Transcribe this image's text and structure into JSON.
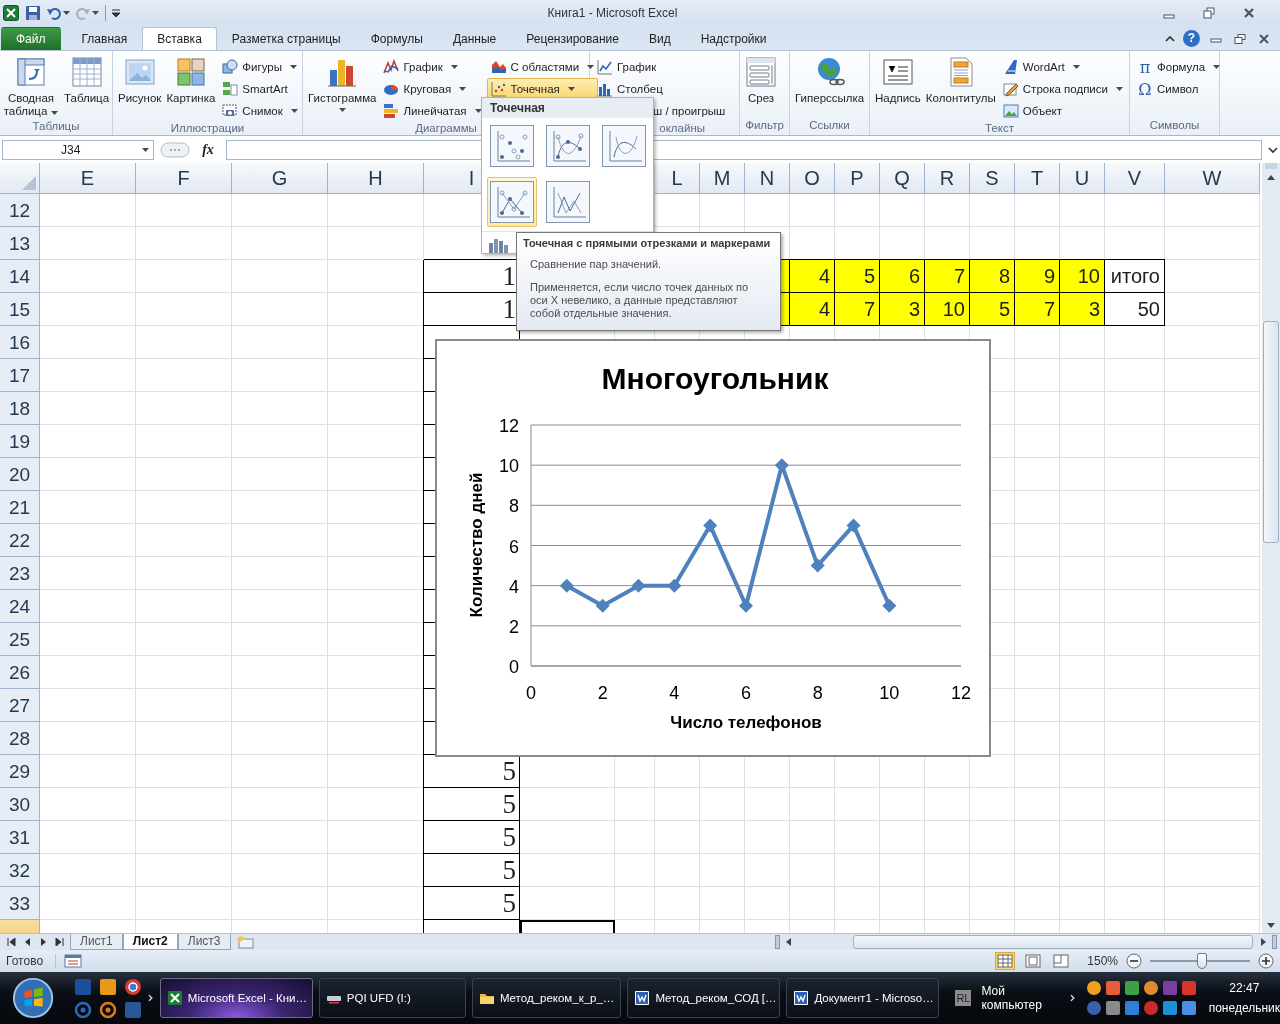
{
  "window": {
    "title": "Книга1  -  Microsoft Excel"
  },
  "tabs": [
    {
      "label": "Файл",
      "kind": "file",
      "selected": false
    },
    {
      "label": "Главная",
      "kind": "tab",
      "selected": false
    },
    {
      "label": "Вставка",
      "kind": "tab",
      "selected": true
    },
    {
      "label": "Разметка страницы",
      "kind": "tab",
      "selected": false
    },
    {
      "label": "Формулы",
      "kind": "tab",
      "selected": false
    },
    {
      "label": "Данные",
      "kind": "tab",
      "selected": false
    },
    {
      "label": "Рецензирование",
      "kind": "tab",
      "selected": false
    },
    {
      "label": "Вид",
      "kind": "tab",
      "selected": false
    },
    {
      "label": "Надстройки",
      "kind": "tab",
      "selected": false
    }
  ],
  "help": "?",
  "ribbon": {
    "groups": [
      {
        "label": "Таблицы",
        "items": [
          {
            "kind": "large",
            "label": "Сводная таблица",
            "dropdown": true
          },
          {
            "kind": "large",
            "label": "Таблица",
            "dropdown": false
          }
        ]
      },
      {
        "label": "Иллюстрации",
        "items": [
          {
            "kind": "large",
            "label": "Рисунок",
            "dropdown": false
          },
          {
            "kind": "large",
            "label": "Картинка",
            "dropdown": false
          },
          {
            "kind": "stack",
            "items": [
              {
                "label": "Фигуры",
                "dropdown": true,
                "selected": false
              },
              {
                "label": "SmartArt",
                "dropdown": false,
                "selected": false
              },
              {
                "label": "Снимок",
                "dropdown": true,
                "selected": false
              }
            ]
          }
        ]
      },
      {
        "label": "Диаграммы",
        "items": [
          {
            "kind": "large",
            "label": "Гистограмма",
            "dropdown": true
          },
          {
            "kind": "stack",
            "items": [
              {
                "label": "График",
                "dropdown": true,
                "selected": false
              },
              {
                "label": "Круговая",
                "dropdown": true,
                "selected": false
              },
              {
                "label": "Линейчатая",
                "dropdown": true,
                "selected": false
              }
            ]
          },
          {
            "kind": "stack",
            "items": [
              {
                "label": "С областями",
                "dropdown": true,
                "selected": false
              },
              {
                "label": "Точечная",
                "dropdown": true,
                "selected": true
              }
            ]
          }
        ]
      },
      {
        "label": "оклайны",
        "items": [
          {
            "kind": "stack",
            "items": [
              {
                "label": "График",
                "dropdown": false,
                "selected": false
              },
              {
                "label": "Столбец",
                "dropdown": false,
                "selected": false
              },
              {
                "label": "ш / проигрыш",
                "kind": "cut",
                "dropdown": false,
                "selected": false
              }
            ]
          }
        ]
      },
      {
        "label": "Фильтр",
        "items": [
          {
            "kind": "large",
            "label": "Срез",
            "dropdown": false
          }
        ]
      },
      {
        "label": "Ссылки",
        "items": [
          {
            "kind": "large",
            "label": "Гиперссылка",
            "dropdown": false
          }
        ]
      },
      {
        "label": "Текст",
        "items": [
          {
            "kind": "large",
            "label": "Надпись",
            "dropdown": false
          },
          {
            "kind": "large",
            "label": "Колонтитулы",
            "dropdown": false
          },
          {
            "kind": "stack",
            "items": [
              {
                "label": "WordArt",
                "dropdown": true,
                "selected": false
              },
              {
                "label": "Строка подписи",
                "dropdown": true,
                "selected": false
              },
              {
                "label": "Объект",
                "dropdown": false,
                "selected": false
              }
            ]
          }
        ]
      },
      {
        "label": "Символы",
        "items": [
          {
            "kind": "stack",
            "items": [
              {
                "label": "Формула",
                "glyph": "π",
                "dropdown": true,
                "selected": false
              },
              {
                "label": "Символ",
                "glyph": "Ω",
                "dropdown": false,
                "selected": false
              }
            ]
          }
        ]
      }
    ]
  },
  "formula_bar": {
    "name_box": "J34",
    "fx": "fx"
  },
  "sheet": {
    "columns_left": [
      "E",
      "F",
      "G",
      "H",
      "I"
    ],
    "columns_right": [
      "L",
      "M",
      "N",
      "O",
      "P",
      "Q",
      "R",
      "S",
      "T",
      "U",
      "V",
      "W"
    ],
    "rows": [
      {
        "number": "12",
        "selected": false
      },
      {
        "number": "13",
        "selected": false
      },
      {
        "number": "14",
        "selected": false,
        "cells": [
          null,
          null,
          null,
          null,
          {
            "text": "1",
            "boxed": true,
            "highlighted": false,
            "selected": false
          },
          null,
          null,
          null,
          null,
          {
            "boxed": true,
            "highlighted": true,
            "selected": false
          },
          {
            "text": "4",
            "boxed": true,
            "highlighted": true,
            "selected": false
          },
          {
            "text": "5",
            "boxed": true,
            "highlighted": true,
            "selected": false
          },
          {
            "text": "6",
            "boxed": true,
            "highlighted": true,
            "selected": false
          },
          {
            "text": "7",
            "boxed": true,
            "highlighted": true,
            "selected": false
          },
          {
            "text": "8",
            "boxed": true,
            "highlighted": true,
            "selected": false
          },
          {
            "text": "9",
            "boxed": true,
            "highlighted": true,
            "selected": false
          },
          {
            "text": "10",
            "boxed": true,
            "highlighted": true,
            "selected": false
          },
          {
            "text": "итого",
            "boxed": true,
            "highlighted": false,
            "selected": false
          }
        ]
      },
      {
        "number": "15",
        "selected": false,
        "cells": [
          null,
          null,
          null,
          null,
          {
            "text": "1",
            "boxed": true,
            "highlighted": false,
            "selected": false
          },
          null,
          null,
          null,
          null,
          {
            "boxed": true,
            "highlighted": true,
            "selected": false
          },
          {
            "text": "4",
            "boxed": true,
            "highlighted": true,
            "selected": false
          },
          {
            "text": "7",
            "boxed": true,
            "highlighted": true,
            "selected": false
          },
          {
            "text": "3",
            "boxed": true,
            "highlighted": true,
            "selected": false
          },
          {
            "text": "10",
            "boxed": true,
            "highlighted": true,
            "selected": false
          },
          {
            "text": "5",
            "boxed": true,
            "highlighted": true,
            "selected": false
          },
          {
            "text": "7",
            "boxed": true,
            "highlighted": true,
            "selected": false
          },
          {
            "text": "3",
            "boxed": true,
            "highlighted": true,
            "selected": false
          },
          {
            "text": "50",
            "boxed": true,
            "highlighted": false,
            "selected": false
          }
        ]
      },
      {
        "number": "16",
        "selected": false,
        "cells": [
          null,
          null,
          null,
          null,
          {
            "boxed": true,
            "highlighted": false,
            "selected": false
          }
        ]
      },
      {
        "number": "17",
        "selected": false,
        "cells": [
          null,
          null,
          null,
          null,
          {
            "boxed": true,
            "highlighted": false,
            "selected": false
          }
        ]
      },
      {
        "number": "18",
        "selected": false,
        "cells": [
          null,
          null,
          null,
          null,
          {
            "boxed": true,
            "highlighted": false,
            "selected": false
          }
        ]
      },
      {
        "number": "19",
        "selected": false,
        "cells": [
          null,
          null,
          null,
          null,
          {
            "boxed": true,
            "highlighted": false,
            "selected": false
          }
        ]
      },
      {
        "number": "20",
        "selected": false,
        "cells": [
          null,
          null,
          null,
          null,
          {
            "boxed": true,
            "highlighted": false,
            "selected": false
          }
        ]
      },
      {
        "number": "21",
        "selected": false,
        "cells": [
          null,
          null,
          null,
          null,
          {
            "boxed": true,
            "highlighted": false,
            "selected": false
          }
        ]
      },
      {
        "number": "22",
        "selected": false,
        "cells": [
          null,
          null,
          null,
          null,
          {
            "boxed": true,
            "highlighted": false,
            "selected": false
          }
        ]
      },
      {
        "number": "23",
        "selected": false,
        "cells": [
          null,
          null,
          null,
          null,
          {
            "boxed": true,
            "highlighted": false,
            "selected": false
          }
        ]
      },
      {
        "number": "24",
        "selected": false,
        "cells": [
          null,
          null,
          null,
          null,
          {
            "boxed": true,
            "highlighted": false,
            "selected": false
          }
        ]
      },
      {
        "number": "25",
        "selected": false,
        "cells": [
          null,
          null,
          null,
          null,
          {
            "boxed": true,
            "highlighted": false,
            "selected": false
          }
        ]
      },
      {
        "number": "26",
        "selected": false,
        "cells": [
          null,
          null,
          null,
          null,
          {
            "boxed": true,
            "highlighted": false,
            "selected": false
          }
        ]
      },
      {
        "number": "27",
        "selected": false,
        "cells": [
          null,
          null,
          null,
          null,
          {
            "boxed": true,
            "highlighted": false,
            "selected": false
          }
        ]
      },
      {
        "number": "28",
        "selected": false,
        "cells": [
          null,
          null,
          null,
          null,
          {
            "boxed": true,
            "highlighted": false,
            "selected": false
          }
        ]
      },
      {
        "number": "29",
        "selected": false,
        "cells": [
          null,
          null,
          null,
          null,
          {
            "text": "5",
            "boxed": true,
            "highlighted": false,
            "selected": false
          }
        ]
      },
      {
        "number": "30",
        "selected": false,
        "cells": [
          null,
          null,
          null,
          null,
          {
            "text": "5",
            "boxed": true,
            "highlighted": false,
            "selected": false
          }
        ]
      },
      {
        "number": "31",
        "selected": false,
        "cells": [
          null,
          null,
          null,
          null,
          {
            "text": "5",
            "boxed": true,
            "highlighted": false,
            "selected": false
          }
        ]
      },
      {
        "number": "32",
        "selected": false,
        "cells": [
          null,
          null,
          null,
          null,
          {
            "text": "5",
            "boxed": true,
            "highlighted": false,
            "selected": false
          }
        ]
      },
      {
        "number": "33",
        "selected": false,
        "cells": [
          null,
          null,
          null,
          null,
          {
            "text": "5",
            "boxed": true,
            "highlighted": false,
            "selected": false
          }
        ]
      },
      {
        "selected": true,
        "cells": [
          null,
          null,
          null,
          null,
          {
            "boxed": true,
            "highlighted": false,
            "selected": false
          },
          {
            "boxed": false,
            "highlighted": false,
            "selected": true
          }
        ]
      }
    ]
  },
  "chart": {
    "chart_data": {
      "type": "line",
      "grid": true,
      "title": "Многоугольник",
      "xlabel": "Число телефонов",
      "ylabel": "Количество дней",
      "x": [
        1,
        2,
        3,
        4,
        5,
        6,
        7,
        8,
        9,
        10
      ],
      "series": [
        {
          "color": "#4f81bd",
          "marker": "diamond",
          "values": [
            4,
            3,
            4,
            4,
            7,
            3,
            10,
            5,
            7,
            3
          ]
        }
      ],
      "xlim": [
        0,
        12
      ],
      "ylim": [
        0,
        12
      ],
      "xticks": [
        0,
        2,
        4,
        6,
        8,
        10,
        12
      ],
      "yticks": [
        0,
        2,
        4,
        6,
        8,
        10,
        12
      ]
    }
  },
  "gallery": {
    "title": "Точечная",
    "options": [
      {
        "selected": false
      },
      {
        "selected": false
      },
      {
        "selected": false
      },
      {
        "selected": true
      },
      {
        "selected": false
      }
    ]
  },
  "tooltip": {
    "title": "Точечная с прямыми отрезками и маркерами",
    "paragraphs": [
      "Сравнение пар значений.",
      "Применяется, если число точек данных по оси X невелико, а данные представляют собой отдельные значения."
    ]
  },
  "sheet_tabs": [
    {
      "label": "Лист1",
      "selected": false
    },
    {
      "label": "Лист2",
      "selected": true
    },
    {
      "label": "Лист3",
      "selected": false
    }
  ],
  "status_bar": {
    "text": "Готово",
    "view_buttons": [
      {
        "selected": true
      },
      {
        "selected": false
      },
      {
        "selected": false
      }
    ],
    "zoom": "150%",
    "zoom_slider": {
      "level": 0.52
    }
  },
  "taskbar": {
    "tasks": [
      {
        "label": "Microsoft Excel - Кни…",
        "kind": "excel",
        "selected": true
      },
      {
        "label": "PQI UFD (I:)",
        "kind": "drive",
        "selected": false
      },
      {
        "label": "Метод_реком_к_р_…",
        "kind": "folder",
        "selected": false
      },
      {
        "label": "Метод_реком_СОД […",
        "kind": "word",
        "selected": false
      },
      {
        "label": "Документ1 - Microso…",
        "kind": "word",
        "selected": false
      }
    ],
    "toolbar": {
      "badge": "RL",
      "label": "Мой компьютер"
    },
    "clock": {
      "time": "22:47",
      "day": "понедельник"
    }
  }
}
